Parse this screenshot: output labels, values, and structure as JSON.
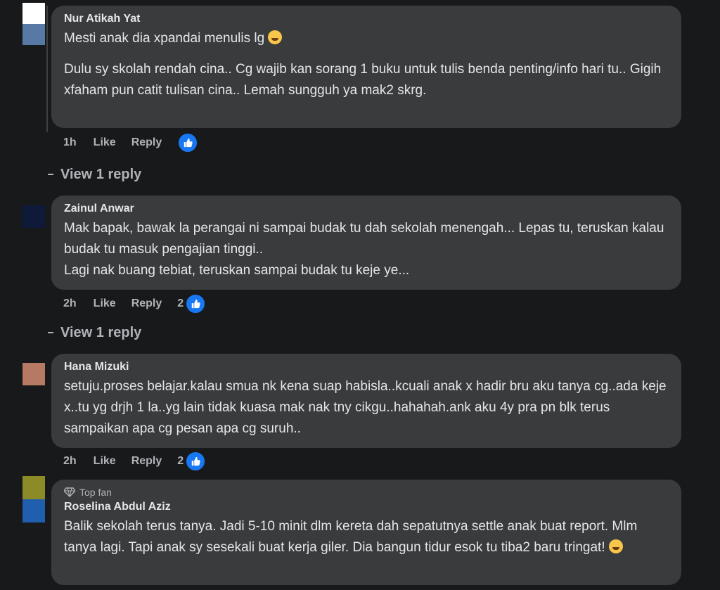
{
  "comments": [
    {
      "author": "Nur Atikah Yat",
      "avatar_colors": [
        "#ffffff",
        "#5879a6"
      ],
      "paragraph_1": "Mesti anak dia xpandai menulis lg",
      "paragraph_2": "Dulu sy skolah rendah cina.. Cg wajib kan sorang 1 buku untuk tulis benda penting/info hari tu.. Gigih xfaham pun catit tulisan cina.. Lemah sungguh ya mak2 skrg.",
      "time": "1h",
      "like_label": "Like",
      "reply_label": "Reply",
      "reaction_count": "",
      "view_replies": "View 1 reply"
    },
    {
      "author": "Zainul Anwar",
      "avatar_colors": [
        "#0f1a3b",
        "#0f1a3b"
      ],
      "text": "Mak bapak, bawak la perangai ni sampai budak tu dah sekolah menengah... Lepas tu, teruskan kalau budak tu masuk pengajian tinggi..\nLagi nak buang tebiat, teruskan sampai budak tu keje ye...",
      "time": "2h",
      "like_label": "Like",
      "reply_label": "Reply",
      "reaction_count": "2",
      "view_replies": "View 1 reply"
    },
    {
      "author": "Hana Mizuki",
      "avatar_colors": [
        "#b67a64",
        "#b67a64"
      ],
      "text": "setuju.proses belajar.kalau smua nk kena suap habisla..kcuali anak x hadir bru aku tanya cg..ada keje x..tu yg drjh 1 la..yg lain tidak kuasa mak nak tny cikgu..hahahah.ank aku 4y pra pn blk terus sampaikan apa cg pesan apa cg suruh..",
      "time": "2h",
      "like_label": "Like",
      "reply_label": "Reply",
      "reaction_count": "2"
    },
    {
      "badge": "Top fan",
      "author": "Roselina Abdul Aziz",
      "avatar_colors": [
        "#8d8a28",
        "#1f5fae"
      ],
      "text": "Balik sekolah terus tanya. Jadi 5-10 minit dlm kereta dah sepatutnya settle anak buat report. Mlm tanya lagi. Tapi anak sy sesekali buat kerja giler. Dia bangun tidur esok tu tiba2 baru tringat!"
    }
  ],
  "icons": {
    "like": "thumbs-up-icon",
    "emoji_laugh": "laughing-emoji-icon",
    "emoji_tired": "tired-emoji-icon",
    "diamond": "diamond-icon"
  },
  "colors": {
    "background": "#18191a",
    "bubble": "#3a3b3c",
    "text": "#e4e6eb",
    "muted": "#b0b3b8",
    "like_blue": "#1877f2"
  }
}
